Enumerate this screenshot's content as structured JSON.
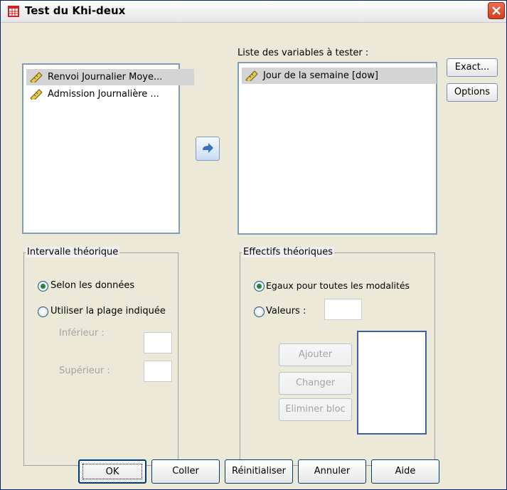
{
  "window": {
    "title": "Test du Khi-deux"
  },
  "source_list": {
    "items": [
      {
        "label": "Renvoi Journalier Moye...",
        "icon": "scale-ruler-icon",
        "selected": true
      },
      {
        "label": "Admission Journalière ...",
        "icon": "scale-ruler-icon",
        "selected": false
      }
    ]
  },
  "test_list": {
    "label": "Liste des variables à tester :",
    "items": [
      {
        "label": "Jour de la semaine [dow]",
        "icon": "scale-ruler-icon",
        "selected": true
      }
    ]
  },
  "side_buttons": {
    "exact": "Exact...",
    "options": "Options"
  },
  "range_group": {
    "title": "Intervalle théorique",
    "option_data": "Selon les données",
    "option_range": "Utiliser la plage indiquée",
    "lower_label": "Inférieur :",
    "upper_label": "Supérieur :",
    "lower_value": "",
    "upper_value": "",
    "selected": "data"
  },
  "expected_group": {
    "title": "Effectifs théoriques",
    "option_equal": "Egaux pour toutes les modalités",
    "option_values": "Valeurs :",
    "values_input": "",
    "add": "Ajouter",
    "change": "Changer",
    "remove": "Eliminer bloc",
    "selected": "equal"
  },
  "footer": {
    "ok": "OK",
    "paste": "Coller",
    "reset": "Réinitialiser",
    "cancel": "Annuler",
    "help": "Aide"
  },
  "colors": {
    "accent": "#3a6fc4",
    "selection": "#d4d4d4",
    "radio_dot": "#2f7d2f",
    "close": "#d0401f"
  }
}
